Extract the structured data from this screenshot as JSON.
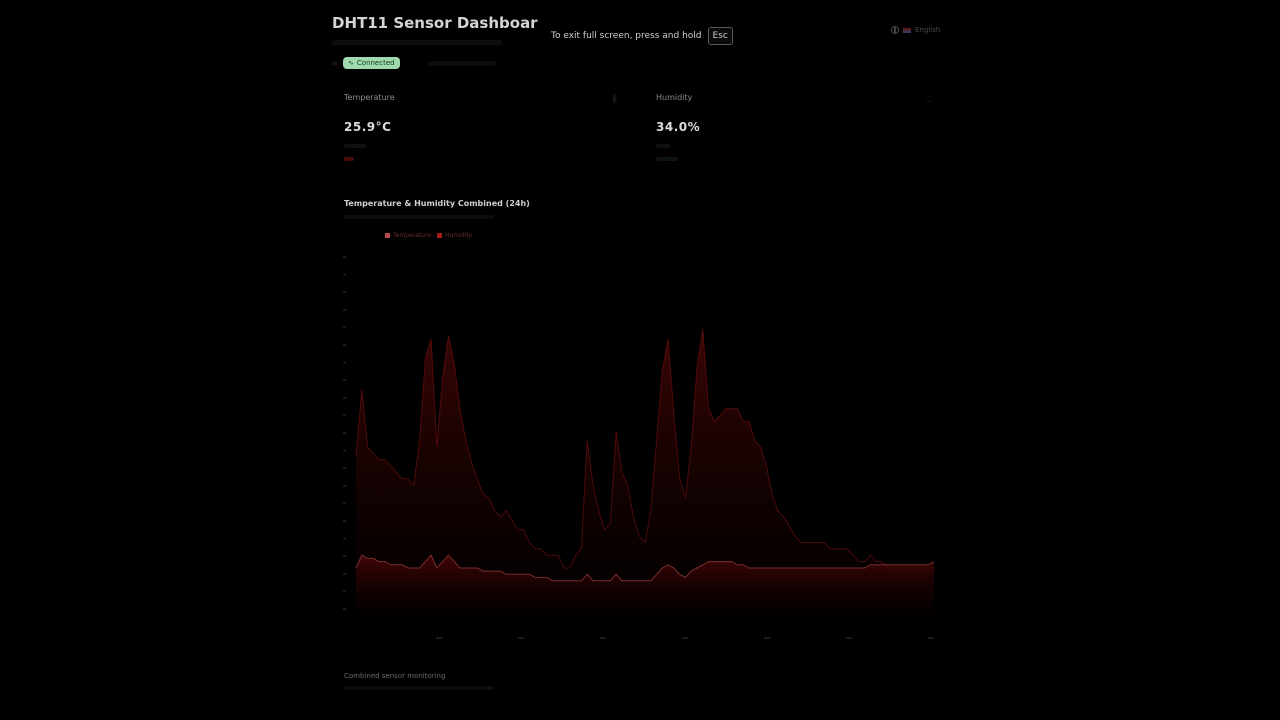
{
  "header": {
    "title": "DHT11 Sensor Dashboar"
  },
  "fullscreen_notice": {
    "text": "To exit full screen, press and hold",
    "key": "Esc"
  },
  "language": {
    "label": "English",
    "icon": "globe-icon"
  },
  "status": {
    "badge_label": "Connected",
    "badge_icon": "activity-icon"
  },
  "cards": {
    "temperature": {
      "label": "Temperature",
      "value": "25.9°C",
      "icon": "thermometer-icon"
    },
    "humidity": {
      "label": "Humidity",
      "value": "34.0%",
      "icon": "droplet-icon"
    }
  },
  "chart": {
    "title": "Temperature & Humidity Combined (24h)"
  },
  "chart_data": {
    "type": "area",
    "title": "Temperature & Humidity Combined (24h)",
    "legend": [
      "Temperature",
      "Humidity"
    ],
    "legend_position": "top-left",
    "grid": false,
    "colors": {
      "temperature": "#b84a4a",
      "humidity": "#a81c1c"
    },
    "x": [
      0,
      1,
      2,
      3,
      4,
      5,
      6,
      7,
      8,
      9,
      10,
      11,
      12,
      13,
      14,
      15,
      16,
      17,
      18,
      19,
      20,
      21,
      22,
      23,
      24,
      25,
      26,
      27,
      28,
      29,
      30,
      31,
      32,
      33,
      34,
      35,
      36,
      37,
      38,
      39,
      40,
      41,
      42,
      43,
      44,
      45,
      46,
      47,
      48,
      49,
      50,
      51,
      52,
      53,
      54,
      55,
      56,
      57,
      58,
      59,
      60,
      61,
      62,
      63,
      64,
      65,
      66,
      67,
      68,
      69,
      70,
      71,
      72,
      73,
      74,
      75,
      76,
      77,
      78,
      79,
      80,
      81,
      82,
      83,
      84,
      85,
      86,
      87,
      88,
      89,
      90,
      91,
      92,
      93,
      94,
      95,
      96,
      97,
      98,
      99,
      100
    ],
    "series": [
      {
        "name": "Humidity",
        "values": [
          57,
          78,
          60,
          58,
          56,
          56,
          54,
          52,
          50,
          50,
          48,
          62,
          88,
          94,
          60,
          82,
          95,
          86,
          72,
          62,
          55,
          50,
          45,
          44,
          40,
          38,
          40,
          37,
          34,
          34,
          30,
          28,
          28,
          26,
          26,
          26,
          22,
          22,
          26,
          28,
          62,
          48,
          40,
          34,
          36,
          65,
          52,
          48,
          38,
          32,
          30,
          40,
          62,
          84,
          94,
          70,
          50,
          44,
          60,
          85,
          97,
          72,
          68,
          70,
          72,
          72,
          72,
          68,
          68,
          62,
          60,
          54,
          45,
          40,
          38,
          35,
          32,
          30,
          30,
          30,
          30,
          30,
          28,
          28,
          28,
          28,
          26,
          24,
          24,
          26,
          24,
          24,
          22,
          22,
          22,
          22,
          22,
          22,
          22,
          22,
          22
        ]
      },
      {
        "name": "Temperature",
        "values": [
          22,
          26,
          25,
          25,
          24,
          24,
          23,
          23,
          23,
          22,
          22,
          22,
          24,
          26,
          22,
          24,
          26,
          24,
          22,
          22,
          22,
          22,
          21,
          21,
          21,
          21,
          20,
          20,
          20,
          20,
          20,
          19,
          19,
          19,
          18,
          18,
          18,
          18,
          18,
          18,
          20,
          18,
          18,
          18,
          18,
          20,
          18,
          18,
          18,
          18,
          18,
          18,
          20,
          22,
          23,
          22,
          20,
          19,
          21,
          22,
          23,
          24,
          24,
          24,
          24,
          24,
          23,
          23,
          22,
          22,
          22,
          22,
          22,
          22,
          22,
          22,
          22,
          22,
          22,
          22,
          22,
          22,
          22,
          22,
          22,
          22,
          22,
          22,
          22,
          23,
          23,
          23,
          23,
          23,
          23,
          23,
          23,
          23,
          23,
          23,
          24
        ]
      }
    ],
    "ylim": [
      0,
      120
    ]
  },
  "footer": {
    "label": "Combined sensor monitoring"
  }
}
